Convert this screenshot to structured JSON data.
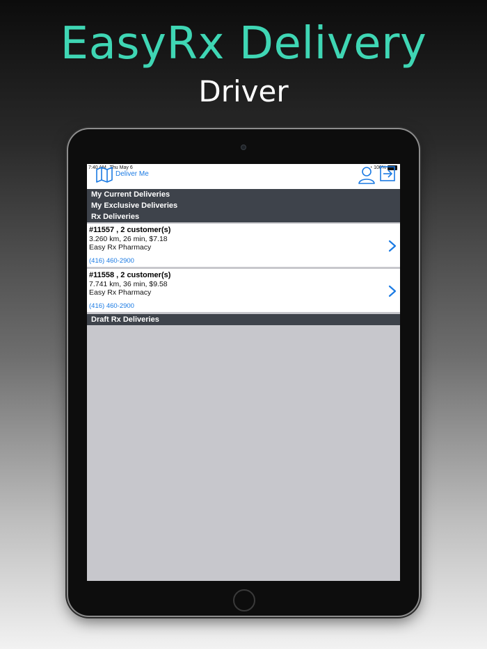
{
  "promo": {
    "title": "EasyRx Delivery",
    "subtitle": "Driver"
  },
  "status_bar": {
    "time": "7:40 AM",
    "date": "Thu May 6",
    "battery": "100%"
  },
  "nav": {
    "title": "Deliver Me",
    "left_icon": "map-icon",
    "right_icons": [
      "user-icon",
      "exit-icon"
    ]
  },
  "menu": {
    "items": [
      "My Current Deliveries",
      "My Exclusive Deliveries",
      "Rx Deliveries"
    ]
  },
  "deliveries": [
    {
      "title": "#11557 , 2 customer(s)",
      "meta": "3.260 km,  26 min, $7.18",
      "pharmacy": "Easy Rx Pharmacy",
      "phone": "(416) 460-2900"
    },
    {
      "title": "#11558 , 2 customer(s)",
      "meta": "7.741 km,  36 min, $9.58",
      "pharmacy": "Easy Rx Pharmacy",
      "phone": "(416) 460-2900"
    }
  ],
  "draft_section": {
    "label": "Draft Rx Deliveries"
  },
  "colors": {
    "accent": "#1a7ae3",
    "promo_title": "#3fd6b4",
    "section_header_bg": "#3e434b",
    "screen_bg": "#c7c7cc"
  }
}
